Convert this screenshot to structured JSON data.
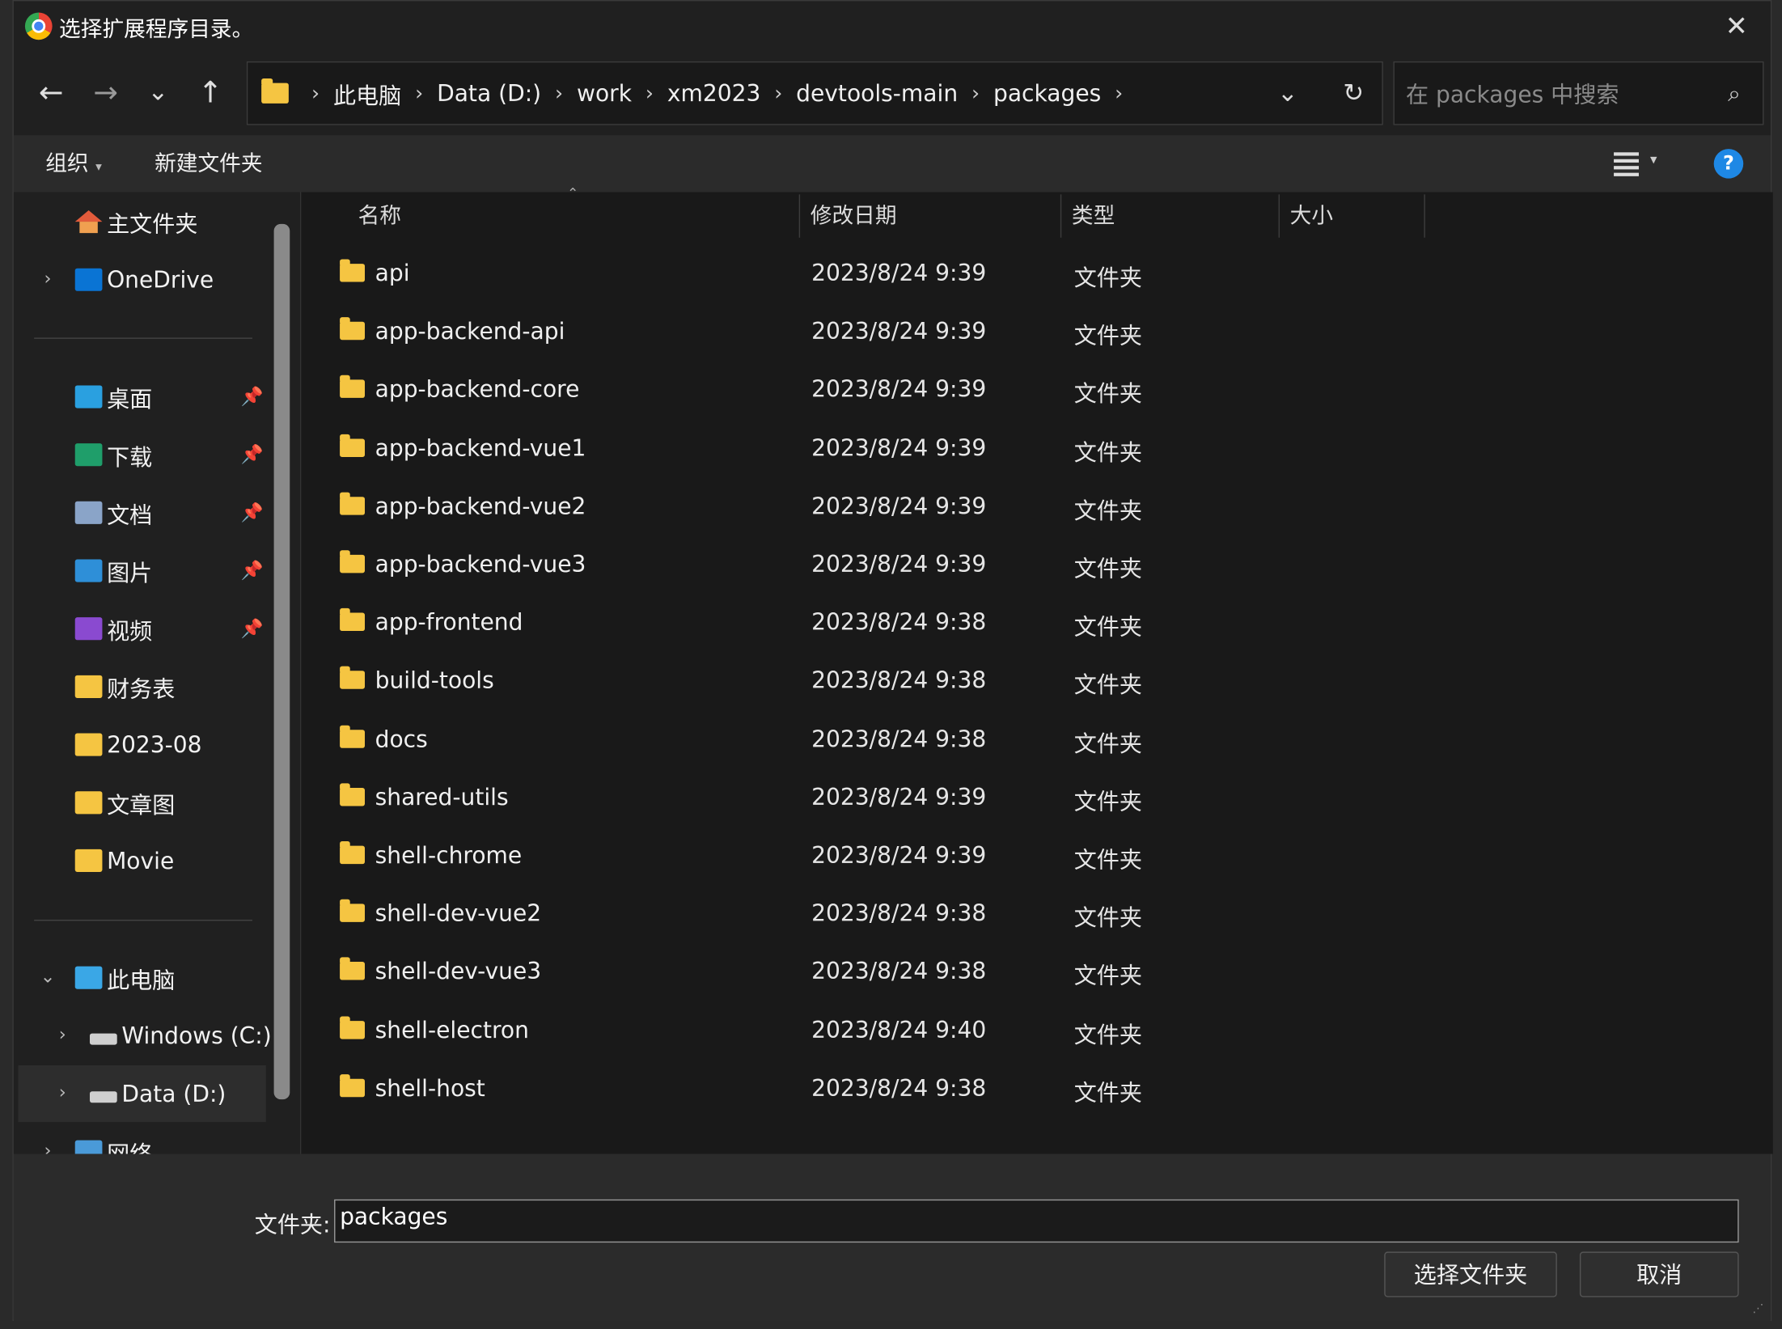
{
  "window": {
    "title": "选择扩展程序目录。",
    "close_glyph": "✕"
  },
  "nav": {
    "back": "←",
    "forward": "→",
    "recent": "⌄",
    "up": "↑"
  },
  "address": {
    "breadcrumbs": [
      "此电脑",
      "Data (D:)",
      "work",
      "xm2023",
      "devtools-main",
      "packages"
    ],
    "separator": "›",
    "dropdown": "⌄",
    "refresh": "↻"
  },
  "search": {
    "placeholder": "在 packages 中搜索",
    "icon": "⌕"
  },
  "toolbar": {
    "organize": "组织",
    "organize_caret": "▾",
    "new_folder": "新建文件夹",
    "view_caret": "▾",
    "help": "?"
  },
  "sidebar": {
    "quick": [
      {
        "label": "主文件夹",
        "icon": "home-icon"
      },
      {
        "label": "OneDrive",
        "icon": "cloud-icon",
        "chevron": "›"
      }
    ],
    "pinned": [
      {
        "label": "桌面",
        "icon": "desktop-icon"
      },
      {
        "label": "下载",
        "icon": "download-icon"
      },
      {
        "label": "文档",
        "icon": "document-icon"
      },
      {
        "label": "图片",
        "icon": "pictures-icon"
      },
      {
        "label": "视频",
        "icon": "videos-icon"
      }
    ],
    "folders": [
      {
        "label": "财务表"
      },
      {
        "label": "2023-08"
      },
      {
        "label": "文章图"
      },
      {
        "label": "Movie"
      }
    ],
    "pc": {
      "label": "此电脑",
      "chevron": "⌄"
    },
    "drives": [
      {
        "label": "Windows (C:)",
        "chevron": "›"
      },
      {
        "label": "Data (D:)",
        "chevron": "›"
      }
    ],
    "network": {
      "label": "网络",
      "chevron": "›"
    },
    "pin_glyph": "📌"
  },
  "columns": {
    "name": "名称",
    "modified": "修改日期",
    "type": "类型",
    "size": "大小",
    "sort_glyph": "⌃"
  },
  "files": [
    {
      "name": "api",
      "date": "2023/8/24 9:39",
      "type": "文件夹"
    },
    {
      "name": "app-backend-api",
      "date": "2023/8/24 9:39",
      "type": "文件夹"
    },
    {
      "name": "app-backend-core",
      "date": "2023/8/24 9:39",
      "type": "文件夹"
    },
    {
      "name": "app-backend-vue1",
      "date": "2023/8/24 9:39",
      "type": "文件夹"
    },
    {
      "name": "app-backend-vue2",
      "date": "2023/8/24 9:39",
      "type": "文件夹"
    },
    {
      "name": "app-backend-vue3",
      "date": "2023/8/24 9:39",
      "type": "文件夹"
    },
    {
      "name": "app-frontend",
      "date": "2023/8/24 9:38",
      "type": "文件夹"
    },
    {
      "name": "build-tools",
      "date": "2023/8/24 9:38",
      "type": "文件夹"
    },
    {
      "name": "docs",
      "date": "2023/8/24 9:38",
      "type": "文件夹"
    },
    {
      "name": "shared-utils",
      "date": "2023/8/24 9:39",
      "type": "文件夹"
    },
    {
      "name": "shell-chrome",
      "date": "2023/8/24 9:39",
      "type": "文件夹"
    },
    {
      "name": "shell-dev-vue2",
      "date": "2023/8/24 9:38",
      "type": "文件夹"
    },
    {
      "name": "shell-dev-vue3",
      "date": "2023/8/24 9:38",
      "type": "文件夹"
    },
    {
      "name": "shell-electron",
      "date": "2023/8/24 9:40",
      "type": "文件夹"
    },
    {
      "name": "shell-host",
      "date": "2023/8/24 9:38",
      "type": "文件夹"
    }
  ],
  "footer": {
    "folder_label": "文件夹:",
    "folder_value": "packages",
    "select_button": "选择文件夹",
    "cancel_button": "取消"
  },
  "colors": {
    "background": "#202020",
    "accent": "#1e88e5",
    "folder": "#f5c542"
  }
}
